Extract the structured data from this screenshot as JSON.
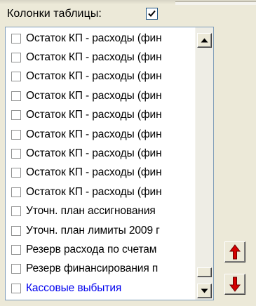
{
  "header": {
    "label": "Колонки таблицы:",
    "checked": true
  },
  "list": {
    "items": [
      {
        "label": "Остаток КП - расходы (фин",
        "checked": false,
        "style": "normal"
      },
      {
        "label": "Остаток КП - расходы (фин",
        "checked": false,
        "style": "normal"
      },
      {
        "label": "Остаток КП - расходы (фин",
        "checked": false,
        "style": "normal"
      },
      {
        "label": "Остаток КП - расходы (фин",
        "checked": false,
        "style": "normal"
      },
      {
        "label": "Остаток КП - расходы (фин",
        "checked": false,
        "style": "normal"
      },
      {
        "label": "Остаток КП - расходы (фин",
        "checked": false,
        "style": "normal"
      },
      {
        "label": "Остаток КП - расходы (фин",
        "checked": false,
        "style": "normal"
      },
      {
        "label": "Остаток КП - расходы (фин",
        "checked": false,
        "style": "normal"
      },
      {
        "label": "Остаток КП - расходы (фин",
        "checked": false,
        "style": "normal"
      },
      {
        "label": "Уточн. план ассигнования",
        "checked": false,
        "style": "normal"
      },
      {
        "label": "Уточн. план лимиты 2009 г",
        "checked": false,
        "style": "normal"
      },
      {
        "label": "Резерв расхода по счетам",
        "checked": false,
        "style": "normal"
      },
      {
        "label": "Резерв финансирования п",
        "checked": false,
        "style": "normal"
      },
      {
        "label": "Кассовые выбытия",
        "checked": false,
        "style": "link"
      }
    ]
  },
  "colors": {
    "window_bg": "#ece9d8",
    "list_border": "#7f9db9",
    "link_text": "#0000ee",
    "arrow_red": "#d40000"
  },
  "icons": {
    "scroll_up": "triangle-up-icon",
    "scroll_down": "triangle-down-icon",
    "move_up": "red-arrow-up-icon",
    "move_down": "red-arrow-down-icon",
    "header_check": "check-icon"
  }
}
